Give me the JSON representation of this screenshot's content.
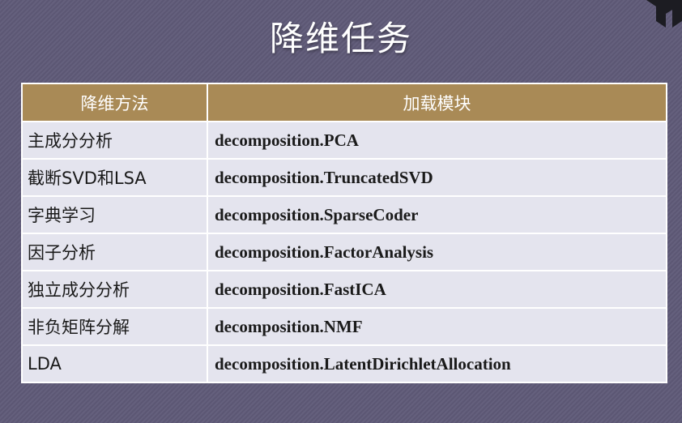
{
  "slide": {
    "title": "降维任务"
  },
  "table": {
    "headers": [
      "降维方法",
      "加载模块"
    ],
    "rows": [
      {
        "method": "主成分分析",
        "module": "decomposition.PCA"
      },
      {
        "method": "截断SVD和LSA",
        "module": "decomposition.TruncatedSVD"
      },
      {
        "method": "字典学习",
        "module": "decomposition.SparseCoder"
      },
      {
        "method": "因子分析",
        "module": "decomposition.FactorAnalysis"
      },
      {
        "method": "独立成分分析",
        "module": "decomposition.FastICA"
      },
      {
        "method": "非负矩阵分解",
        "module": "decomposition.NMF"
      },
      {
        "method": "LDA",
        "module": "decomposition.LatentDirichletAllocation"
      }
    ]
  },
  "colors": {
    "background": "#5f5a78",
    "header": "#a98a56",
    "row": "#e4e4ee"
  },
  "icons": {
    "logo": "brand-logo-icon"
  }
}
